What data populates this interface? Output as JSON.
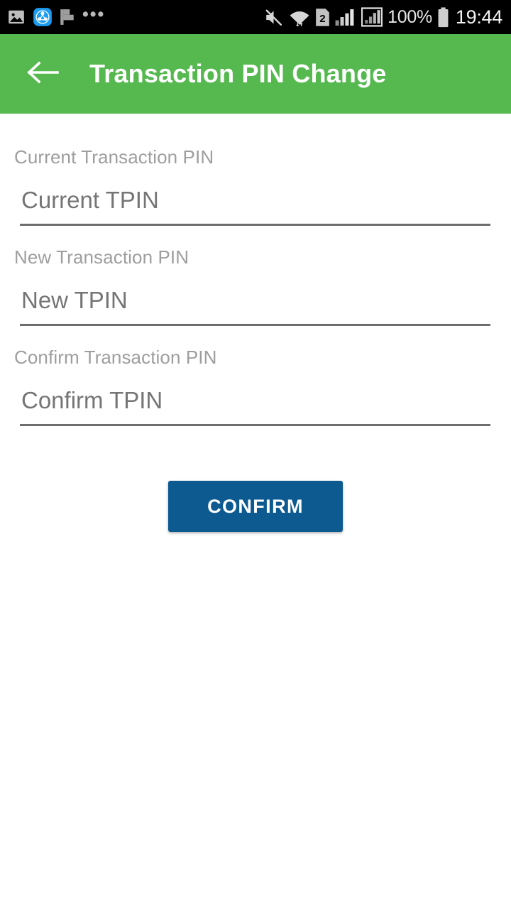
{
  "status_bar": {
    "background": "#000000",
    "left_icons": [
      {
        "name": "gallery-icon",
        "label": "image"
      },
      {
        "name": "shareit-app-icon",
        "label": "shareit"
      },
      {
        "name": "flag-icon",
        "label": "flag"
      }
    ],
    "overflow": "•••",
    "right_icons": [
      {
        "name": "mute-icon",
        "label": "sound off"
      },
      {
        "name": "wifi-icon",
        "label": "wifi"
      },
      {
        "name": "sim-icon",
        "label": "2"
      },
      {
        "name": "signal-bars-icon",
        "label": "signal"
      },
      {
        "name": "signal-boxed-icon",
        "label": "signal 2"
      }
    ],
    "battery_percent": "100%",
    "clock": "19:44"
  },
  "app_bar": {
    "background": "#55b94f",
    "back_icon": "arrow-left-icon",
    "title": "Transaction PIN Change"
  },
  "form": {
    "fields": [
      {
        "id": "current-tpin",
        "label": "Current Transaction PIN",
        "placeholder": "Current TPIN",
        "value": ""
      },
      {
        "id": "new-tpin",
        "label": "New Transaction PIN",
        "placeholder": "New TPIN",
        "value": ""
      },
      {
        "id": "confirm-tpin",
        "label": "Confirm Transaction PIN",
        "placeholder": "Confirm TPIN",
        "value": ""
      }
    ],
    "submit_label": "CONFIRM",
    "submit_color": "#0d5a91"
  },
  "colors": {
    "accent_green": "#55b94f",
    "button_blue": "#0d5a91",
    "label_gray": "#9e9e9e",
    "input_gray": "#6e6e6e"
  }
}
